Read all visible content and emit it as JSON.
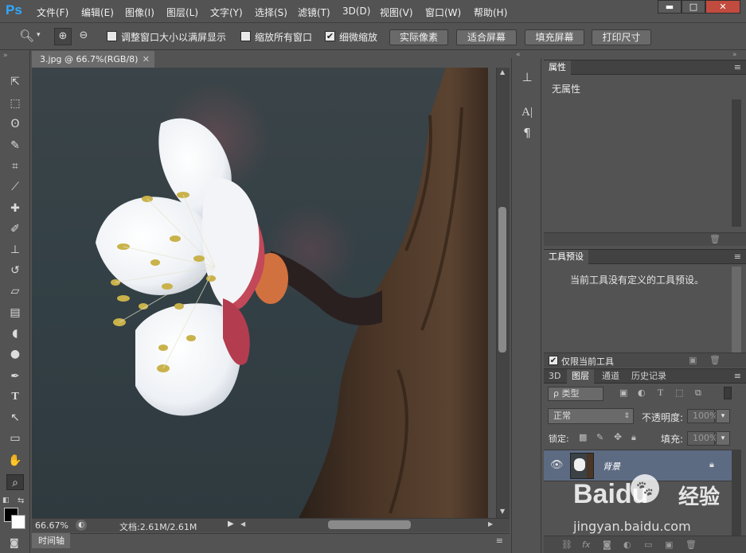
{
  "app": {
    "logo": "Ps"
  },
  "menu": [
    "文件(F)",
    "编辑(E)",
    "图像(I)",
    "图层(L)",
    "文字(Y)",
    "选择(S)",
    "滤镜(T)",
    "3D(D)",
    "视图(V)",
    "窗口(W)",
    "帮助(H)"
  ],
  "window_controls": {
    "minimize": "▬",
    "maximize": "□",
    "close": "✕"
  },
  "options": {
    "checkbox1_label": "调整窗口大小以满屏显示",
    "checkbox1_checked": false,
    "checkbox2_label": "缩放所有窗口",
    "checkbox2_checked": false,
    "checkbox3_label": "细微缩放",
    "checkbox3_checked": true,
    "btn_actual": "实际像素",
    "btn_fit": "适合屏幕",
    "btn_fill": "填充屏幕",
    "btn_print": "打印尺寸"
  },
  "document": {
    "tab_title": "3.jpg @ 66.7%(RGB/8)",
    "zoom": "66.67%",
    "doc_info": "文档:2.61M/2.61M"
  },
  "timeline": {
    "label": "时间轴"
  },
  "properties": {
    "tab": "属性",
    "empty_text": "无属性"
  },
  "tool_presets": {
    "tab": "工具预设",
    "empty_text": "当前工具没有定义的工具预设。",
    "only_current_label": "仅限当前工具",
    "only_current_checked": true
  },
  "layers": {
    "tabs": [
      "3D",
      "图层",
      "通道",
      "历史记录"
    ],
    "active_tab": "图层",
    "filter_label": "ρ 类型",
    "blend_mode": "正常",
    "opacity_label": "不透明度:",
    "opacity_value": "100%",
    "lock_label": "锁定:",
    "fill_label": "填充:",
    "fill_value": "100%",
    "layer_name": "背景"
  },
  "watermark": {
    "brand": "Baidu",
    "cn": "经验",
    "url": "jingyan.baidu.com"
  },
  "colors": {
    "accent": "#31a8ff",
    "selected_layer": "#5c6b82",
    "ui_bg": "#535353"
  }
}
